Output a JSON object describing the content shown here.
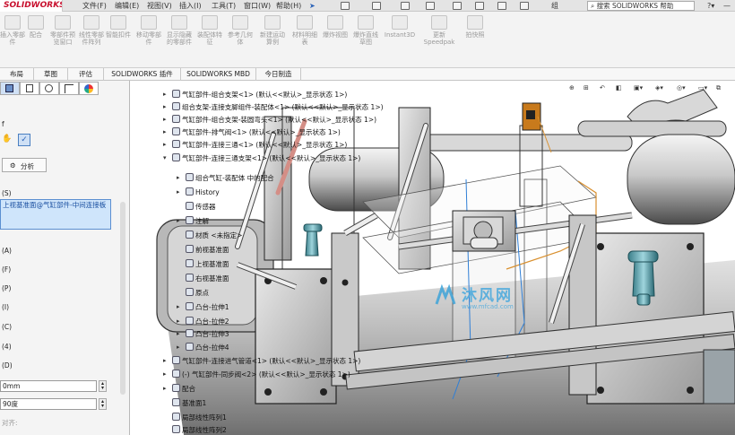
{
  "app": {
    "logo": "SOLIDWORKS",
    "brand_color": "#c8102e"
  },
  "menus": [
    "文件(F)",
    "编辑(E)",
    "视图(V)",
    "插入(I)",
    "工具(T)",
    "窗口(W)",
    "帮助(H)"
  ],
  "topbar": {
    "partial": "组合…",
    "search_placeholder": "搜索 SOLIDWORKS 帮助"
  },
  "ribbon": [
    "插入零部件",
    "配合",
    "零部件预览窗口",
    "线性零部件阵列",
    "智能扣件",
    "移动零部件",
    "显示隐藏的零部件",
    "装配体特征",
    "参考几何体",
    "新建运动算例",
    "材料明细表",
    "爆炸视图",
    "爆炸直线草图",
    "Instant3D",
    "更新Speedpak",
    "拍快照"
  ],
  "command_tabs": [
    "布局",
    "草图",
    "评估",
    "SOLIDWORKS 插件",
    "SOLIDWORKS MBD",
    "今日制造"
  ],
  "left_panel": {
    "label_top": "f",
    "tab_analysis": "分析",
    "section1": "(S)",
    "selection": "上视基准面@气缸部件-中间连接板",
    "section2": "(A)",
    "opt1": "(F)",
    "opt2": "(P)",
    "opt3": "(I)",
    "opt4": "(C)",
    "opt5": "(4)",
    "section3": "(D)",
    "distance": "0mm",
    "angle": "90度",
    "align": "对齐:"
  },
  "tree": [
    "气缸部件-组合支架<1> (默认<<默认>_显示状态 1>)",
    "组合支架-连接支脚组件-装配体<1> (默认<<默认>_显示状态 1>)",
    "气缸部件-组合支架-装圆弯头<1> (默认<<默认>_显示状态 1>)",
    "气缸部件-排气阀<1> (默认<<默认>_显示状态 1>)",
    "气缸部件-连接三通<1> (默认<<默认>_显示状态 1>)",
    "气缸部件-连接三通支架<1> (默认<<默认>_显示状态 1>)",
    "组合气缸-装配体 中的配合",
    "History",
    "传感器",
    "注解",
    "材质 <未指定>",
    "前视基准面",
    "上视基准面",
    "右视基准面",
    "原点",
    "凸台-拉伸1",
    "凸台-拉伸2",
    "凸台-拉伸3",
    "凸台-拉伸4",
    "气缸部件-连接进气管道<1> (默认<<默认>_显示状态 1>)",
    "(-) 气缸部件-同步阀<2> (默认<<默认>_显示状态 1>)",
    "配合",
    "基准面1",
    "局部线性阵列1",
    "局部线性阵列2"
  ],
  "watermark": {
    "main": "沐风网",
    "sub": "www.mfcad.com"
  }
}
